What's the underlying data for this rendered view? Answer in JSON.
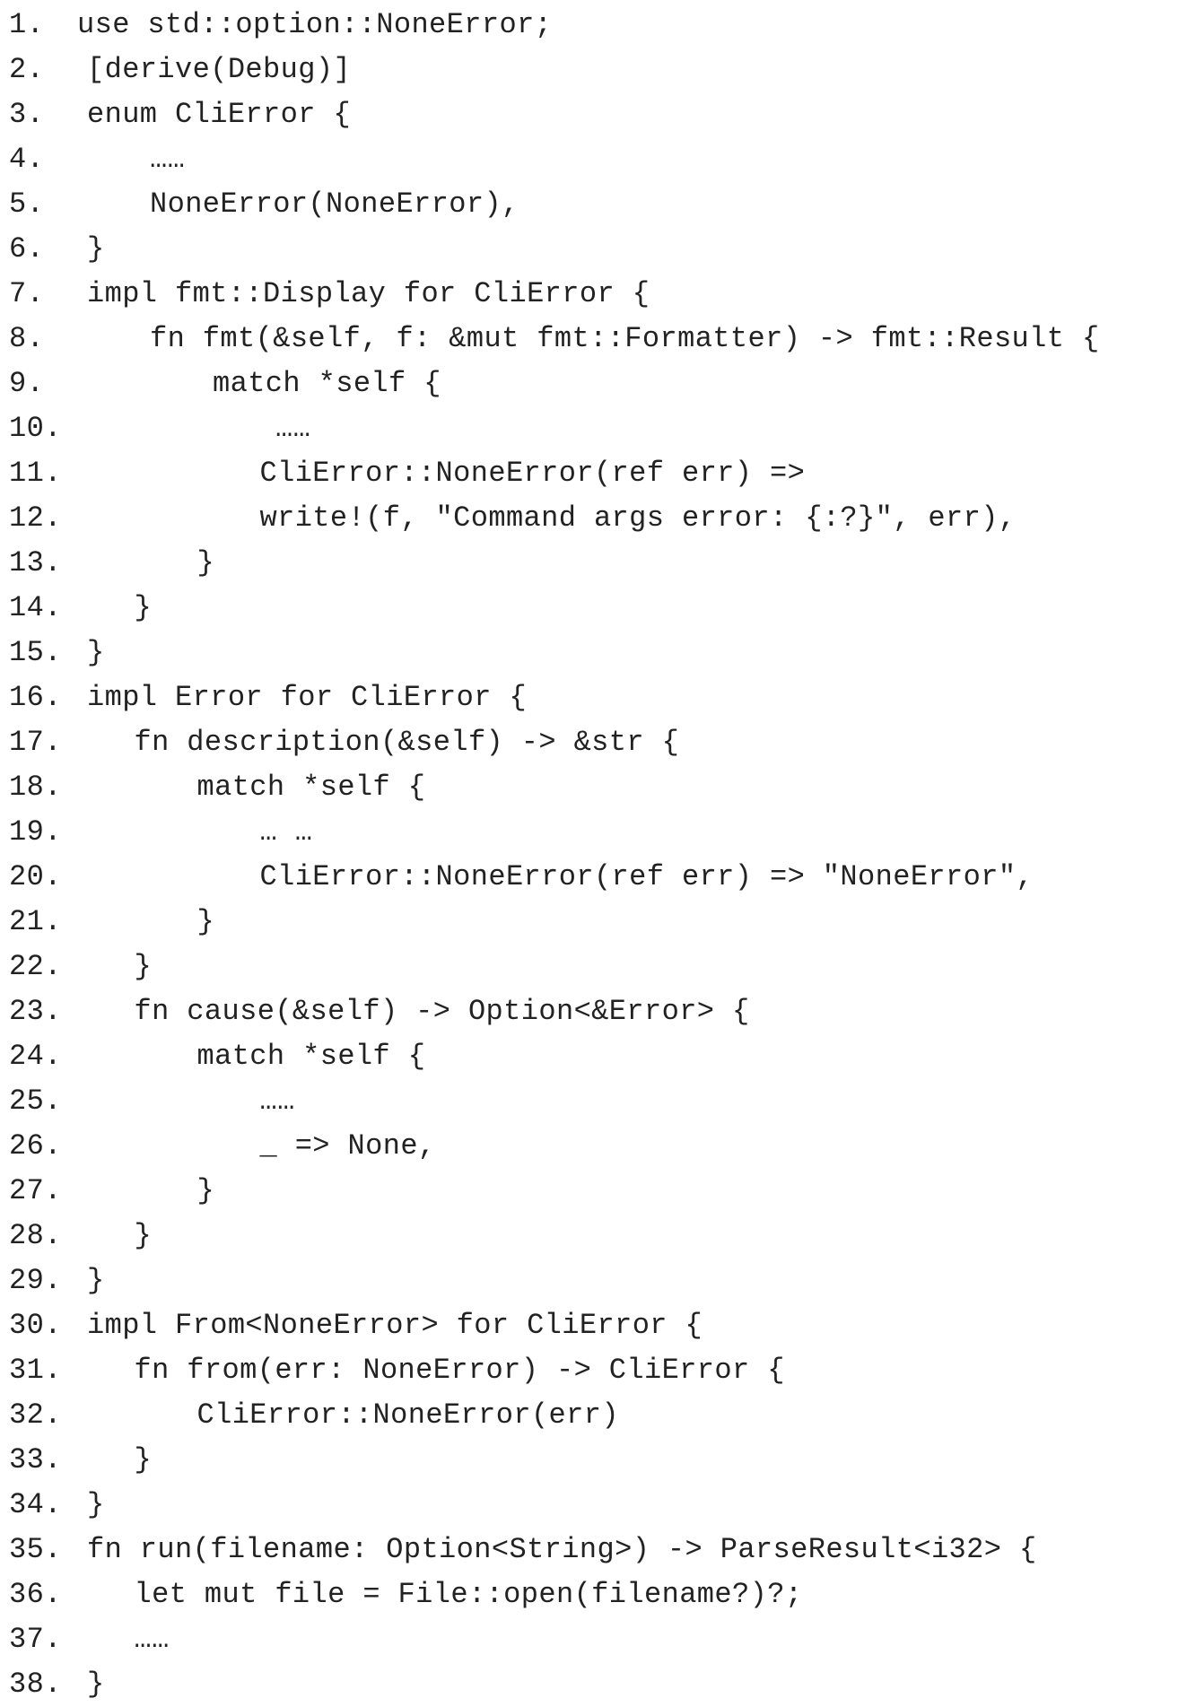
{
  "code_listing": {
    "lines": [
      {
        "number": "1.",
        "code": "use std::option::NoneError;",
        "indent": 0
      },
      {
        "number": "2.",
        "code": "[derive(Debug)]",
        "indent": 1
      },
      {
        "number": "3.",
        "code": "enum CliError {",
        "indent": 1
      },
      {
        "number": "4.",
        "code": "……",
        "indent": 5
      },
      {
        "number": "5.",
        "code": "NoneError(NoneError),",
        "indent": 5
      },
      {
        "number": "6.",
        "code": "}",
        "indent": 1
      },
      {
        "number": "7.",
        "code": "impl fmt::Display for CliError {",
        "indent": 1
      },
      {
        "number": "8.",
        "code": "fn fmt(&self, f: &mut fmt::Formatter) -> fmt::Result {",
        "indent": 5
      },
      {
        "number": "9.",
        "code": "match *self {",
        "indent": 9
      },
      {
        "number": "10.",
        "code": "……",
        "indent": 13
      },
      {
        "number": "11.",
        "code": "CliError::NoneError(ref err) =>",
        "indent": 12
      },
      {
        "number": "12.",
        "code": "write!(f, \"Command args error: {:?}\", err),",
        "indent": 12
      },
      {
        "number": "13.",
        "code": "}",
        "indent": 8
      },
      {
        "number": "14.",
        "code": "}",
        "indent": 4
      },
      {
        "number": "15.",
        "code": "}",
        "indent": 1
      },
      {
        "number": "16.",
        "code": "impl Error for CliError {",
        "indent": 1
      },
      {
        "number": "17.",
        "code": "fn description(&self) -> &str {",
        "indent": 4
      },
      {
        "number": "18.",
        "code": "match *self {",
        "indent": 8
      },
      {
        "number": "19.",
        "code": "… …",
        "indent": 12
      },
      {
        "number": "20.",
        "code": "CliError::NoneError(ref err) => \"NoneError\",",
        "indent": 12
      },
      {
        "number": "21.",
        "code": "}",
        "indent": 8
      },
      {
        "number": "22.",
        "code": "}",
        "indent": 4
      },
      {
        "number": "23.",
        "code": "fn cause(&self) -> Option<&Error> {",
        "indent": 4
      },
      {
        "number": "24.",
        "code": "match *self {",
        "indent": 8
      },
      {
        "number": "25.",
        "code": "……",
        "indent": 12
      },
      {
        "number": "26.",
        "code": "_ => None,",
        "indent": 12
      },
      {
        "number": "27.",
        "code": "}",
        "indent": 8
      },
      {
        "number": "28.",
        "code": "}",
        "indent": 4
      },
      {
        "number": "29.",
        "code": "}",
        "indent": 1
      },
      {
        "number": "30.",
        "code": "impl From<NoneError> for CliError {",
        "indent": 1
      },
      {
        "number": "31.",
        "code": "fn from(err: NoneError) -> CliError {",
        "indent": 4
      },
      {
        "number": "32.",
        "code": "CliError::NoneError(err)",
        "indent": 8
      },
      {
        "number": "33.",
        "code": "}",
        "indent": 4
      },
      {
        "number": "34.",
        "code": "}",
        "indent": 1
      },
      {
        "number": "35.",
        "code": "fn run(filename: Option<String>) -> ParseResult<i32> {",
        "indent": 1
      },
      {
        "number": "36.",
        "code": "let mut file = File::open(filename?)?;",
        "indent": 4
      },
      {
        "number": "37.",
        "code": "……",
        "indent": 4
      },
      {
        "number": "38.",
        "code": "}",
        "indent": 1
      }
    ]
  }
}
